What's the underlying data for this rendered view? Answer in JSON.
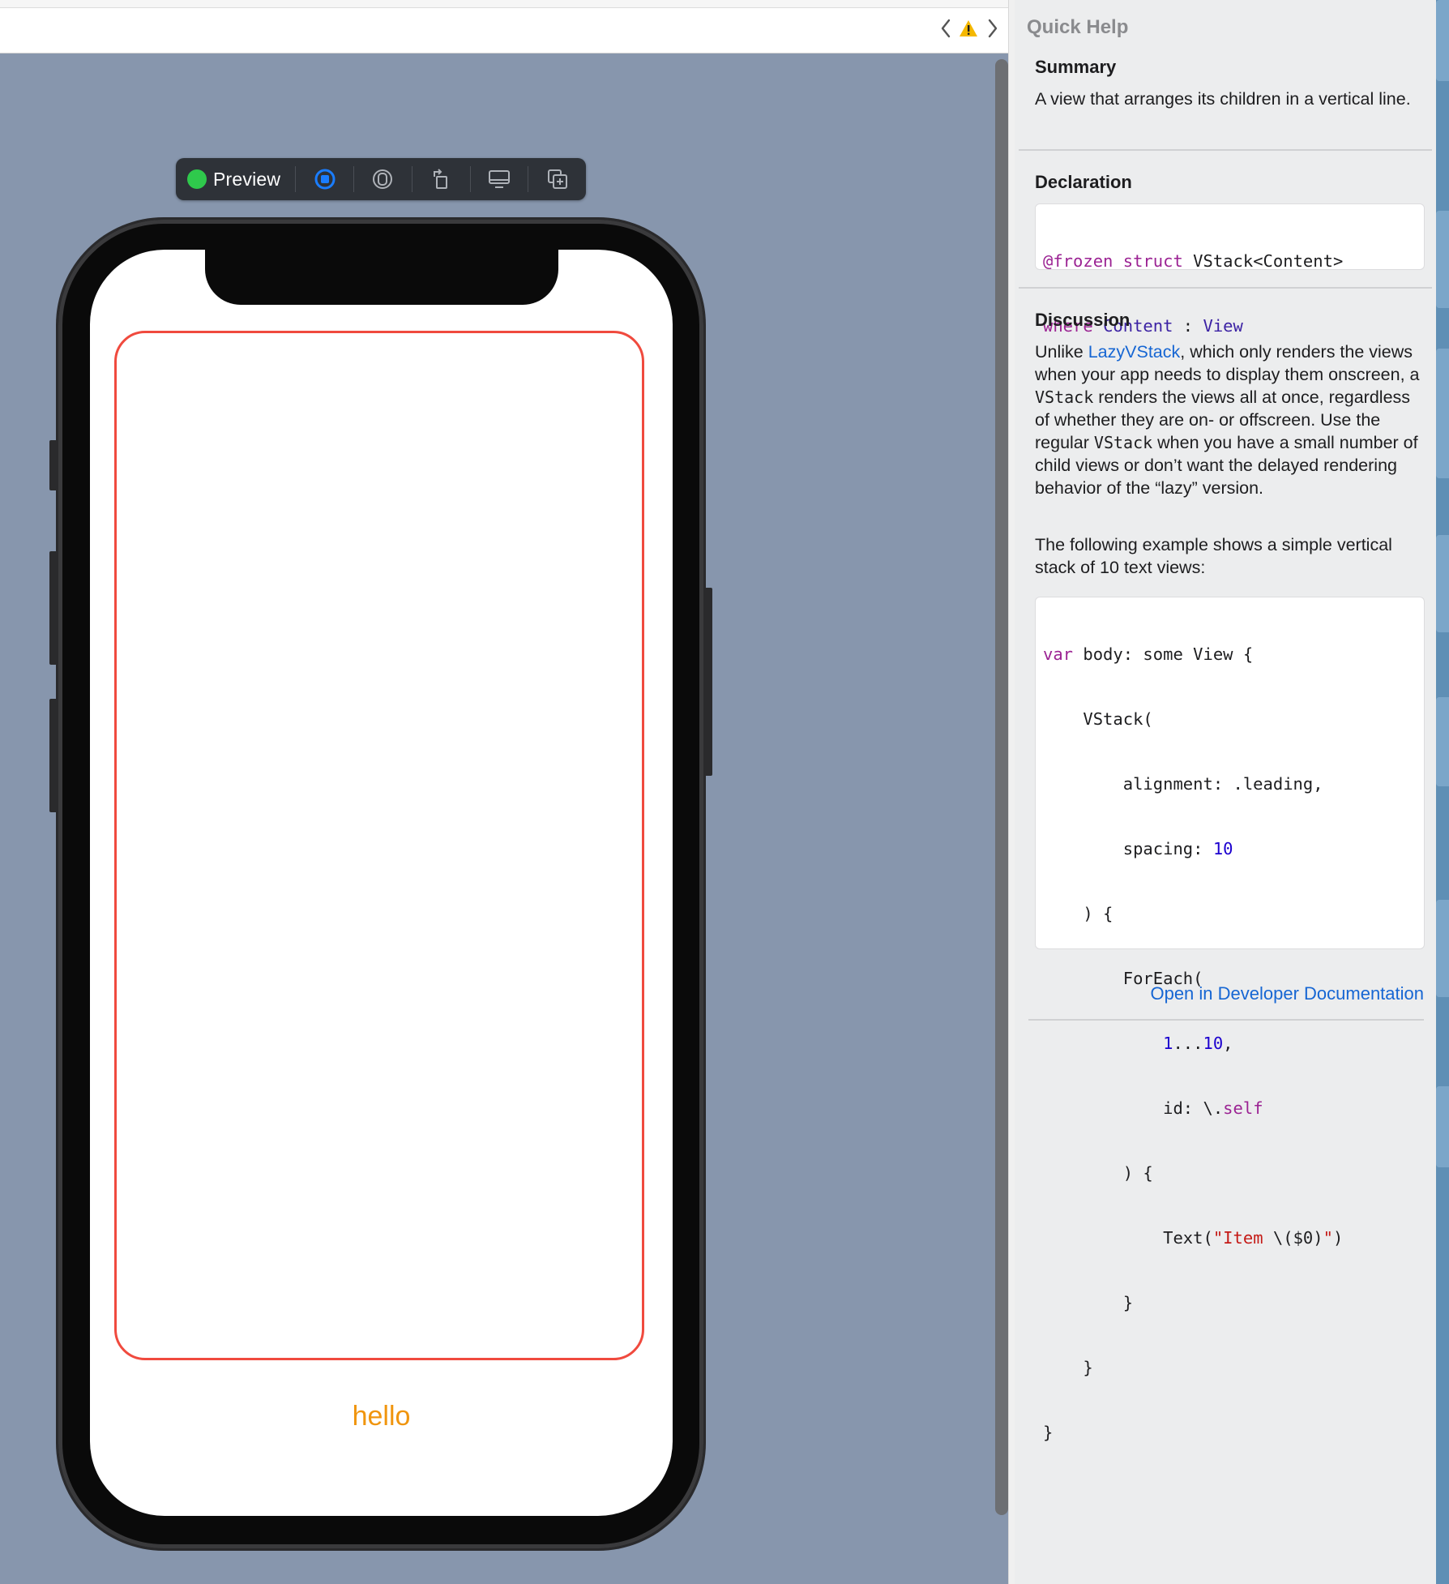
{
  "toolbar": {
    "nav_back_icon": "chevron-left-icon",
    "warning_icon": "warning-triangle-icon",
    "nav_forward_icon": "chevron-right-icon",
    "warning_color": "#f5b800"
  },
  "preview_bar": {
    "status_label": "Preview",
    "status_color": "#2fc94c",
    "buttons": [
      "live-preview-icon",
      "selectable-icon",
      "rotate-icon",
      "device-settings-icon",
      "duplicate-icon"
    ]
  },
  "device": {
    "content_text": "hello",
    "content_color": "#f0950e",
    "border_color": "#f04a3e"
  },
  "quick_help": {
    "title": "Quick Help",
    "summary_heading": "Summary",
    "summary_text": "A view that arranges its children in a vertical line.",
    "declaration_heading": "Declaration",
    "declaration": {
      "line1": {
        "attr": "@frozen",
        "kw": "struct",
        "rest": " VStack<Content>"
      },
      "line2": {
        "kw": "where",
        "type1": "Content",
        "sep": " : ",
        "type2": "View"
      }
    },
    "discussion_heading": "Discussion",
    "discussion": {
      "p1_before_link": "Unlike ",
      "p1_link": "LazyVStack",
      "p1_after_link": ", which only renders the views when your app needs to display them onscreen, a ",
      "p1_code1": "VStack",
      "p1_mid": " renders the views all at once, regardless of whether they are on- or offscreen. Use the regular ",
      "p1_code2": "VStack",
      "p1_end": " when you have a small number of child views or don’t want the delayed rendering behavior of the “lazy” version.",
      "p2": "The following example shows a simple vertical stack of 10 text views:"
    },
    "code_example": {
      "l1_kw": "var",
      "l1_rest": " body: some View {",
      "l2": "    VStack(",
      "l3": "        alignment: .leading,",
      "l4_a": "        spacing: ",
      "l4_num": "10",
      "l5": "    ) {",
      "l6": "        ForEach(",
      "l7_a": "            ",
      "l7_num1": "1",
      "l7_mid": "...",
      "l7_num2": "10",
      "l7_end": ",",
      "l8_a": "            id: \\.",
      "l8_kw": "self",
      "l9": "        ) {",
      "l10_a": "            Text(",
      "l10_str1": "\"Item ",
      "l10_b": "\\(",
      "l10_c": "$0",
      "l10_d": ")",
      "l10_str2": "\"",
      "l10_e": ")",
      "l11": "        }",
      "l12": "    }",
      "l13": "}"
    },
    "open_docs_link": "Open in Developer Documentation"
  }
}
